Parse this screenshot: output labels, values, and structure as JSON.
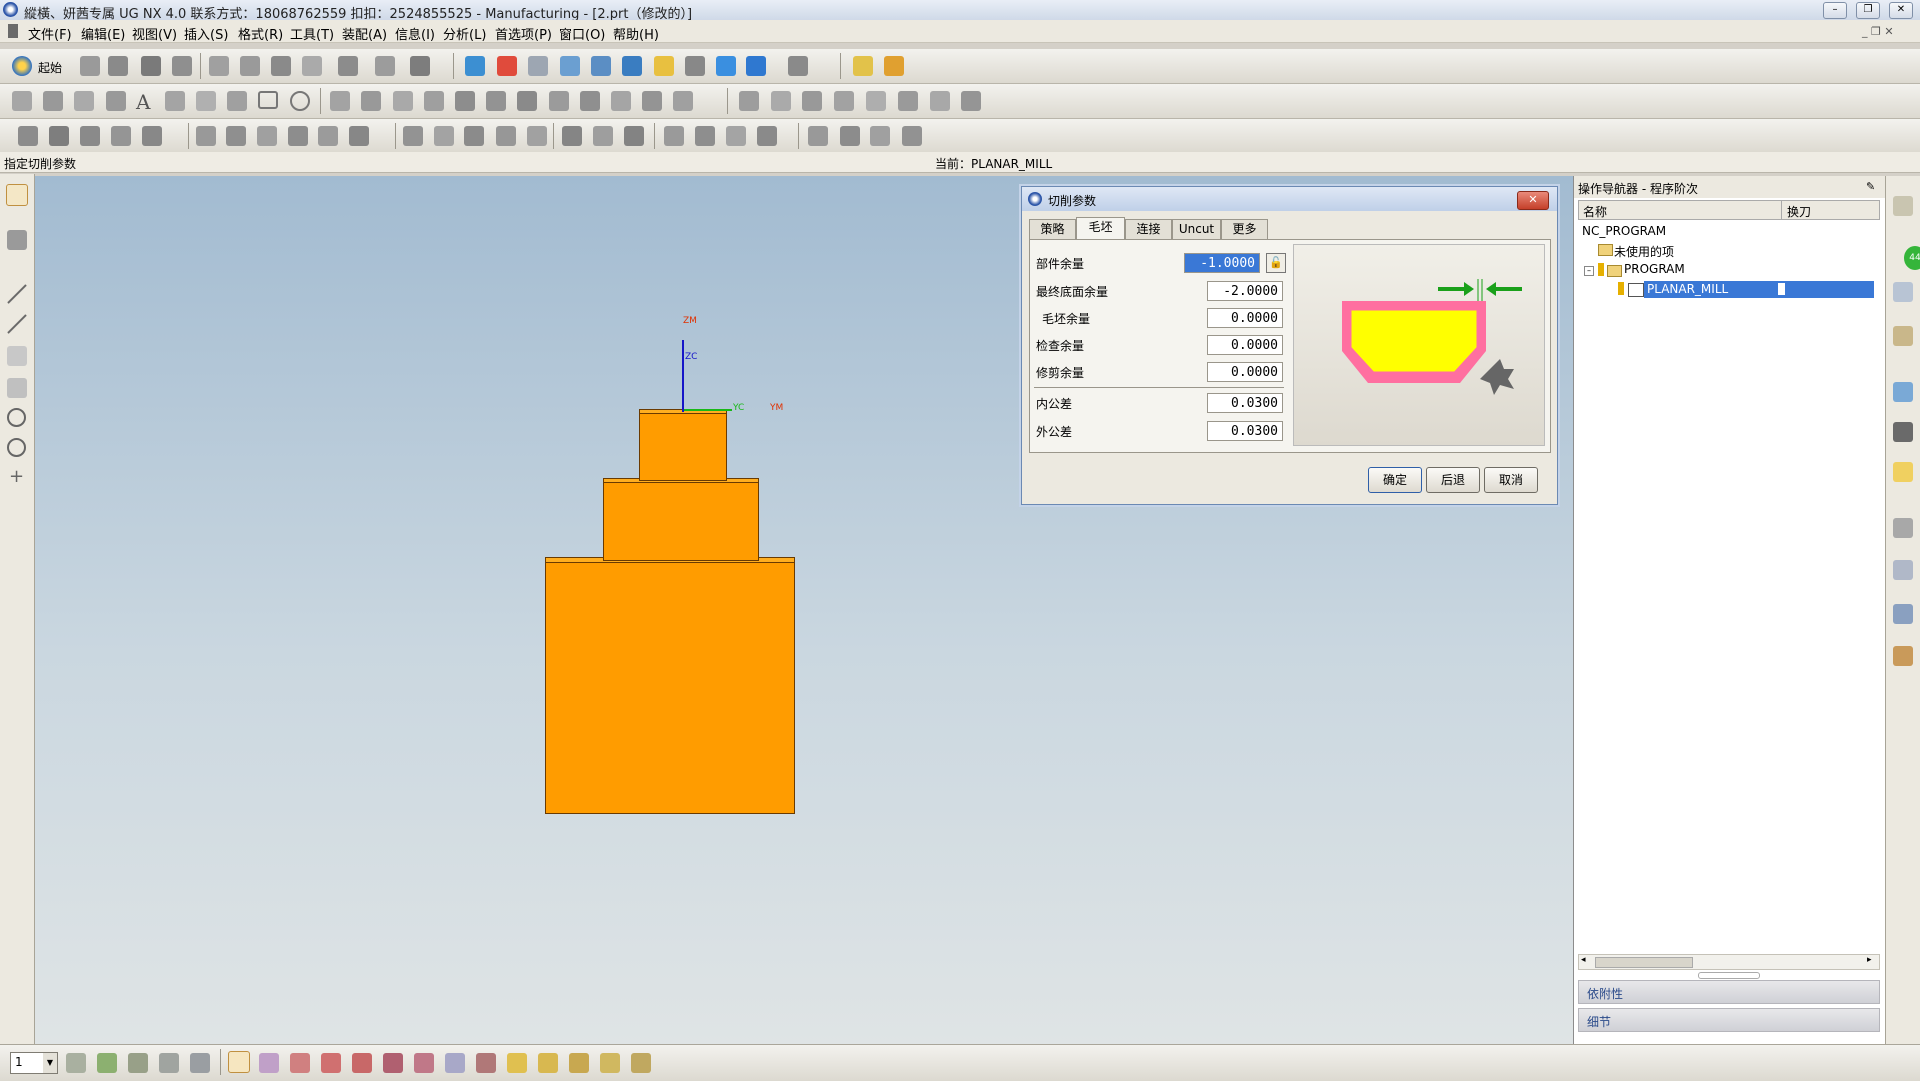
{
  "window": {
    "title": "縱橫、妍茜专属 UG NX 4.0 联系方式：18068762559 扣扣：2524855525 - Manufacturing - [2.prt（修改的）]"
  },
  "menu": [
    "文件(F)",
    "编辑(E)",
    "视图(V)",
    "插入(S)",
    "格式(R)",
    "工具(T)",
    "装配(A)",
    "信息(I)",
    "分析(L)",
    "首选项(P)",
    "窗口(O)",
    "帮助(H)"
  ],
  "toolbar": {
    "start_label": "起始"
  },
  "status": {
    "prompt": "指定切削参数",
    "current": "当前：PLANAR_MILL"
  },
  "axes": {
    "zm": "ZM",
    "zc": "ZC",
    "yc": "YC",
    "ym": "YM"
  },
  "dialog": {
    "title": "切削参数",
    "tabs": [
      "策略",
      "毛坯",
      "连接",
      "Uncut",
      "更多"
    ],
    "active_tab": "毛坯",
    "fields": [
      {
        "label": "部件余量",
        "value": "-1.0000"
      },
      {
        "label": "最终底面余量",
        "value": "-2.0000"
      },
      {
        "label": "毛坯余量",
        "value": "0.0000"
      },
      {
        "label": "检查余量",
        "value": "0.0000"
      },
      {
        "label": "修剪余量",
        "value": "0.0000"
      },
      {
        "label": "内公差",
        "value": "0.0300"
      },
      {
        "label": "外公差",
        "value": "0.0300"
      }
    ],
    "ok": "确定",
    "back": "后退",
    "cancel": "取消"
  },
  "navigator": {
    "title": "操作导航器 - 程序阶次",
    "col_name": "名称",
    "col_tool": "换刀",
    "items": {
      "root": "NC_PROGRAM",
      "unused": "未使用的项",
      "program": "PROGRAM",
      "op": "PLANAR_MILL"
    },
    "panel1": "依附性",
    "panel2": "细节"
  },
  "bottom": {
    "layer": "1"
  },
  "colors": {
    "part": "#ff9c00",
    "accent": "#3a78d6",
    "viewport_top": "#a2bbd1"
  }
}
